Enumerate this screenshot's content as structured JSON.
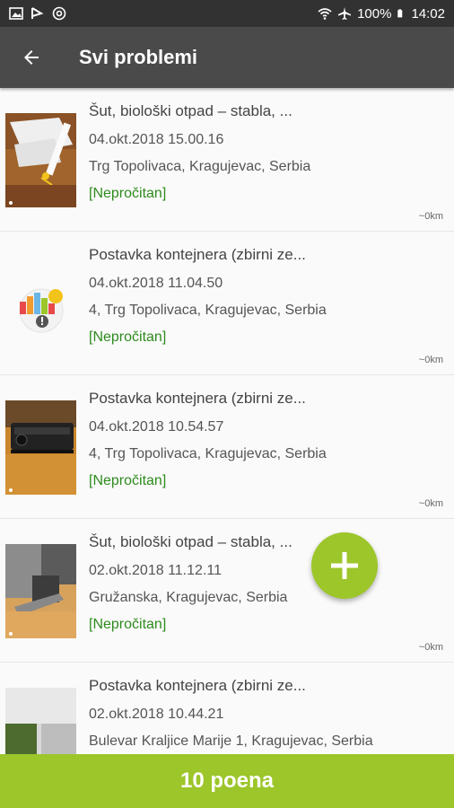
{
  "status_bar": {
    "battery": "100%",
    "time": "14:02",
    "icons": [
      "image-icon",
      "flag-icon",
      "at-icon",
      "wifi-icon",
      "airplane-icon",
      "battery-icon"
    ]
  },
  "app_bar": {
    "title": "Svi problemi",
    "back_icon": "arrow-back-icon"
  },
  "problems": [
    {
      "title": "Šut, biološki otpad – stabla, ...",
      "date": "04.okt.2018 15.00.16",
      "address": "Trg Topolivaca, Kragujevac, Serbia",
      "status": "[Nepročitan]",
      "distance": "~0km",
      "thumb": "photo-papers-desk"
    },
    {
      "title": "Postavka kontejnera (zbirni ze...",
      "date": "04.okt.2018 11.04.50",
      "address": "4, Trg Topolivaca, Kragujevac, Serbia",
      "status": "[Nepročitan]",
      "distance": "~0km",
      "thumb": "app-logo-placeholder"
    },
    {
      "title": "Postavka kontejnera (zbirni ze...",
      "date": "04.okt.2018 10.54.57",
      "address": "4, Trg Topolivaca, Kragujevac, Serbia",
      "status": "[Nepročitan]",
      "distance": "~0km",
      "thumb": "photo-projector"
    },
    {
      "title": "Šut, biološki otpad – stabla, ...",
      "date": "02.okt.2018 11.12.11",
      "address": "Gružanska, Kragujevac, Serbia",
      "status": "[Nepročitan]",
      "distance": "~0km",
      "thumb": "photo-chair-floor"
    },
    {
      "title": "Postavka kontejnera (zbirni ze...",
      "date": "02.okt.2018 10.44.21",
      "address": "Bulevar Kraljice Marije 1, Kragujevac, Serbia",
      "status": "",
      "distance": "",
      "thumb": "photo-outdoor-wall"
    }
  ],
  "fab": {
    "icon": "plus-icon"
  },
  "bottom_bar": {
    "points_label": "10 poena"
  },
  "colors": {
    "accent": "#9cc62a",
    "app_bar": "#4a4a4a",
    "status_bar": "#323232",
    "status_text": "#2e8b1e"
  }
}
